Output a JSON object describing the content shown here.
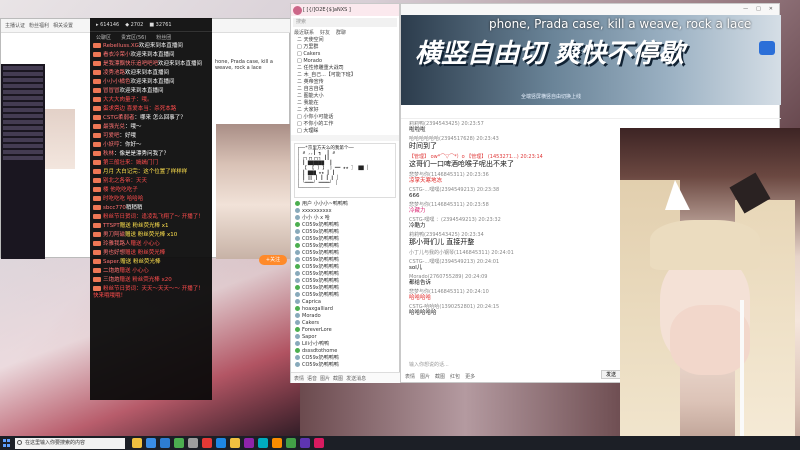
{
  "taskbar": {
    "search_placeholder": "在这里输入你要搜索的内容",
    "time": "",
    "icons": [
      "file-explorer-icon",
      "browser-icon",
      "mail-icon",
      "chat-icon",
      "settings-icon",
      "media-icon",
      "qq-icon",
      "folder-icon",
      "app-icon",
      "app-icon",
      "app-icon",
      "app-icon",
      "app-icon",
      "app-icon"
    ]
  },
  "left_window": {
    "title_items": [
      "主播认证",
      "粉丝福利",
      "相关设置"
    ],
    "marquee": "hone, Prada case, kill a weave, rock a lace",
    "follow_label": "+关注"
  },
  "left_chat": {
    "header": [
      "▸ 614146",
      "◆ 2702",
      "■ 32761"
    ],
    "tabs": [
      "公聊区",
      "贵宾区(56)",
      "粉丝团"
    ],
    "messages": [
      {
        "name": "Rebelluss.XG",
        "text": "欢迎来到本直播间",
        "style": "normal"
      },
      {
        "name": "看衣冷荣小",
        "text": "欢迎来到本直播间",
        "style": "normal"
      },
      {
        "name": "是我漂飘快乐追吧吧吧",
        "text": "欢迎来到本直播间",
        "style": "normal"
      },
      {
        "name": "凌秀池路",
        "text": "欢迎来到本直播间",
        "style": "normal"
      },
      {
        "name": "小小小橘色",
        "text": "欢迎来到本直播间",
        "style": "normal"
      },
      {
        "name": "冒冒冒",
        "text": "欢迎来到本直播间",
        "style": "normal"
      },
      {
        "name": "",
        "text": "大大大肉量子：哦。",
        "style": "red"
      },
      {
        "name": "",
        "text": "蛋求旁边 喜爱本当：杀死本路",
        "style": "red"
      },
      {
        "name": "CSTG柔弱者",
        "text": "：哪来 怎么回事了？",
        "style": "normal"
      },
      {
        "name": "最强光兑",
        "text": "：哦～",
        "style": "normal"
      },
      {
        "name": "可爱吧",
        "text": "：好哦",
        "style": "normal"
      },
      {
        "name": "小妖哼",
        "text": "：你好～",
        "style": "normal"
      },
      {
        "name": "秋林",
        "text": "：像是是漂秀问我了？",
        "style": "normal"
      },
      {
        "name": "",
        "text": "第三般壮来：嫣嫣门门",
        "style": "red"
      },
      {
        "name": "",
        "text": "月月 大白记完：这个位置了样样样",
        "style": "yellow"
      },
      {
        "name": "",
        "text": "别北之各帝：天天",
        "style": "red"
      },
      {
        "name": "",
        "text": "楼 他吃吃吃子",
        "style": "red"
      },
      {
        "name": "",
        "text": "时吃吃吃 哈哈哈",
        "style": "red"
      },
      {
        "name": "sbcc770",
        "text": "稍稍稍",
        "style": "normal"
      },
      {
        "name": "",
        "text": "粉丝节日贺词：逢凌乱飞翔了～ 开播了！",
        "style": "red"
      },
      {
        "name": "TTSPT",
        "text": "赠送 粉丝荧光棒 x1",
        "style": "yellow"
      },
      {
        "name": "男刀阿磁",
        "text": "赠送 粉丝荧光棒 x10",
        "style": "yellow"
      },
      {
        "name": "玲雅我路人",
        "text": "赠送 小心心",
        "style": "red"
      },
      {
        "name": "男也好想",
        "text": "赠送 粉丝荧光棒",
        "style": "red"
      },
      {
        "name": "Saper.",
        "text": "赠送 粉丝荧光棒",
        "style": "yellow"
      },
      {
        "name": "二炮炮",
        "text": "赠送 小心心",
        "style": "red"
      },
      {
        "name": "三炮炮",
        "text": "赠送 粉丝荧光棒 x20",
        "style": "red"
      },
      {
        "name": "",
        "text": "粉丝节日贺词：天天～天天～～ 开播了！快来哦哦哦！",
        "style": "red"
      }
    ]
  },
  "middle_window": {
    "title": "[ [{/]O2E{$]aNXS ]",
    "search_placeholder": "搜索",
    "tabs": [
      "最近联系",
      "好友",
      "群聊"
    ],
    "tree_items": [
      "ニ 天使空间",
      "□ 万里群",
      "□ Cakers",
      "□ Morado",
      "ニ 任性修雕重大战司",
      "ニ 木_自己...【可能下班】",
      "ニ 英帝宣传",
      "ニ 自言自语",
      "ニ 图能大小",
      "ニ 我能在",
      "ニ 大家好",
      "□ 小你小可能话",
      "□ 不你小的工作",
      "□ 大理睬"
    ],
    "ascii_art": "┌──*京里方天么的我第个──\n│ ∂ ,,┃ ┓  ┃ ∂\n│ ┌┐┌┐┌┐┐ ┃┃\n│ ┃ ▇▇▇▇▇▇  ┃\n│ 【 【 ] 】 ] ══ ★★ 〗 ▇▇ │\n│ ┃ ▇▇▇ ★★ ┃ ┃\n│ ┃ ∥∥ ┃ ┃ ┃ ∥ │\n│ ╰═══╯ ════╯ │\n└───────────",
    "users": [
      "用户 小小小~鸭鸭鸭",
      "xxxxxxxxxx",
      "小小 小 x 哈",
      "CO59x奶鸭鸭鸭",
      "CO59x奶鸭鸭鸭",
      "CO59x奶鸭鸭鸭",
      "CO59x奶鸭鸭鸭",
      "CO59x奶鸭鸭鸭",
      "CO59x奶鸭鸭鸭",
      "CO59x奶鸭鸭鸭",
      "CO59x奶鸭鸭鸭",
      "CO59x奶鸭鸭鸭",
      "CO59x奶鸭鸭鸭",
      "CO59x奶鸭鸭鸭",
      "Caprica",
      "hoaxgalliard",
      "Morado",
      "Cakers",
      "ForeverLore",
      "Sapor",
      "Lili小小鸭鸭",
      "dsssdtothome",
      "CO59x奶鸭鸭鸭",
      "CO59x奶鸭鸭鸭"
    ],
    "bottom": [
      "表情",
      "语音",
      "图片",
      "截图",
      "发送消息"
    ]
  },
  "right_window": {
    "title": "",
    "controls": [
      "—",
      "□",
      "✕"
    ],
    "banner": {
      "title": "横竖自由切 爽快不停歇",
      "sub": "全端竖屏横竖自由切换上线",
      "marquee": "phone, Prada case, kill a weave, rock a lace"
    },
    "messages": [
      {
        "meta": "莉莉鸭(2394543425)  20:23:57",
        "text": "啦啦啦",
        "meta_style": "gray",
        "text_style": "normal"
      },
      {
        "meta": "哈哈哈哈哈哈(2394517628)  20:23:43",
        "text": "时间到了",
        "meta_style": "gray",
        "text_style": "big"
      },
      {
        "meta": "【管理】 ow*⌒▽⌒*）o 【管理】 (1453271...)  20:23:14",
        "text": "这哥们一口啤酒呛喉子呢出不来了",
        "meta_style": "red",
        "text_style": "big"
      },
      {
        "meta": "悲梦与你(1146845311)  20:23:36",
        "text": "凉掌天寒地冻",
        "meta_style": "gray",
        "text_style": "red"
      },
      {
        "meta": "CSTG-…嘿嘿(2394549213)  20:23:38",
        "text": "666",
        "meta_style": "gray",
        "text_style": "normal"
      },
      {
        "meta": "悲梦与你(1146845311)  20:23:58",
        "text": "冷藏力",
        "meta_style": "gray",
        "text_style": "pink"
      },
      {
        "meta": "CSTG-嘿嘿 ：(2394549213)  20:23:32",
        "text": "冷酷力",
        "meta_style": "gray",
        "text_style": "normal"
      },
      {
        "meta": "莉莉鸭(2394543425)  20:23:34",
        "text": "那小哥们儿 直接开整",
        "meta_style": "gray",
        "text_style": "big"
      },
      {
        "meta": "小丁儿与我的小钢琴(1146845311)  20:24:01",
        "text": "",
        "meta_style": "gray",
        "text_style": "normal"
      },
      {
        "meta": "CSTG-…嘿嘿(2394549213)  20:24:01",
        "text": "sol儿",
        "meta_style": "gray",
        "text_style": "normal"
      },
      {
        "meta": "Morado(2760755289)  20:24:09",
        "text": "都给告诉",
        "meta_style": "gray",
        "text_style": "normal"
      },
      {
        "meta": "悲梦与你(1146845311)  20:24:10",
        "text": "哈哈哈哈",
        "meta_style": "gray",
        "text_style": "red"
      },
      {
        "meta": "CSTG-哈哈哈(1390252801)  20:24:15",
        "text": "哈哈哈哈哈",
        "meta_style": "gray",
        "text_style": "normal"
      }
    ],
    "input_placeholder": "输入你想说的话...",
    "bottom_tools": [
      "表情",
      "图片",
      "截图",
      "红包",
      "更多"
    ],
    "send_label": "发送"
  },
  "colors": {
    "accent": "#ff8a2a",
    "chat_red": "#ff4d4d",
    "link_blue": "#2b77d2"
  }
}
